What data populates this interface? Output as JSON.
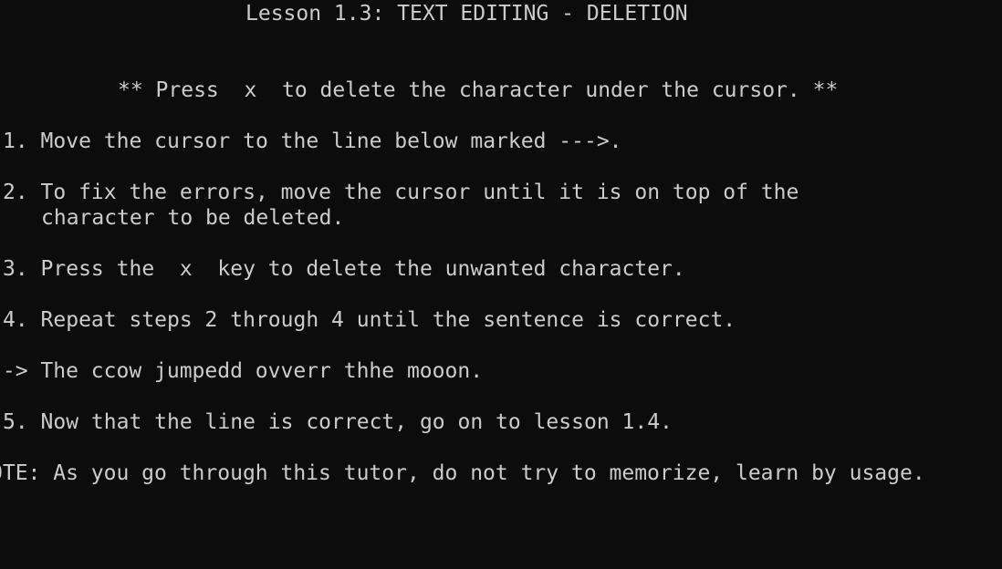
{
  "lesson": {
    "title": "Lesson 1.3: TEXT EDITING - DELETION",
    "instruction": "** Press  x  to delete the character under the cursor. **",
    "step1": "1. Move the cursor to the line below marked --->.",
    "step2a": "2. To fix the errors, move the cursor until it is on top of the",
    "step2b": "character to be deleted.",
    "step3": "3. Press the  x  key to delete the unwanted character.",
    "step4": "4. Repeat steps 2 through 4 until the sentence is correct.",
    "practice": "--> The ccow jumpedd ovverr thhe mooon.",
    "step5": "5. Now that the line is correct, go on to lesson 1.4.",
    "note": "OTE: As you go through this tutor, do not try to memorize, learn by usage."
  },
  "colors": {
    "background": "#0c0c0c",
    "foreground": "#cccccc"
  }
}
